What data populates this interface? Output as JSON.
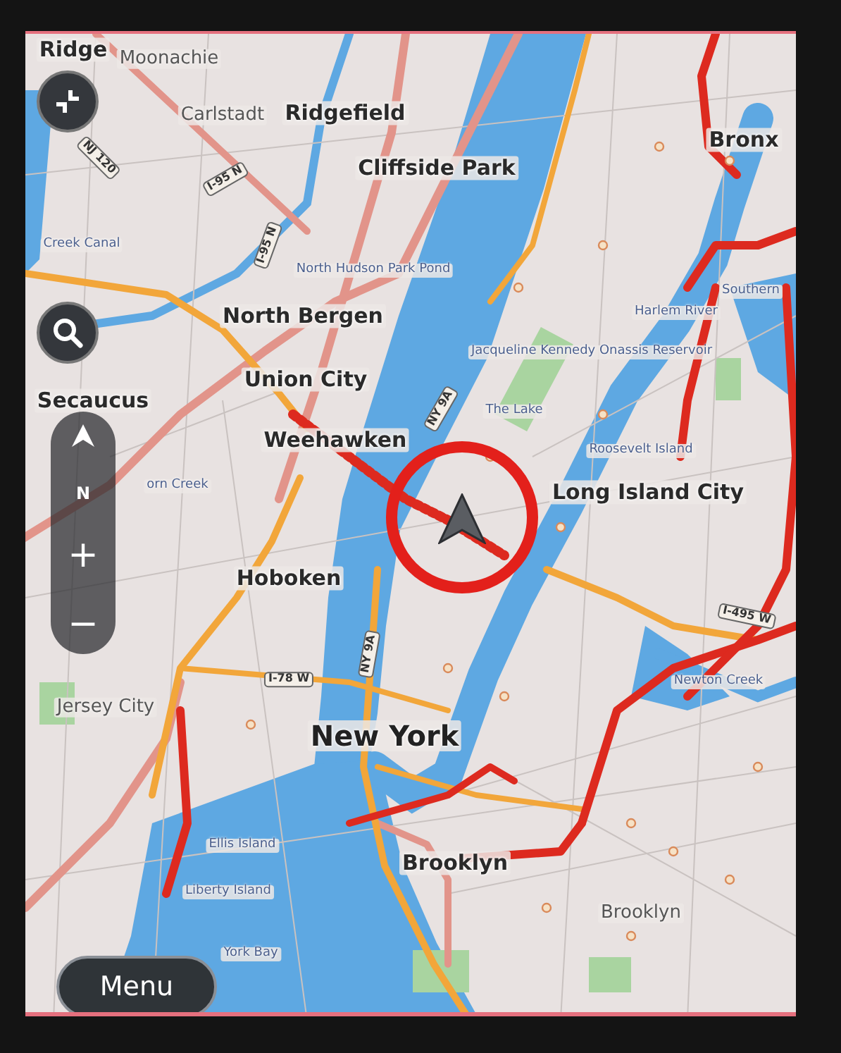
{
  "map": {
    "labels": [
      {
        "text": "Ridge",
        "kind": "town"
      },
      {
        "text": "Moonachie",
        "kind": "district"
      },
      {
        "text": "Carlstadt",
        "kind": "district"
      },
      {
        "text": "Ridgefield",
        "kind": "town"
      },
      {
        "text": "Cliffside Park",
        "kind": "town"
      },
      {
        "text": "Bronx",
        "kind": "town"
      },
      {
        "text": "Creek Canal",
        "kind": "water"
      },
      {
        "text": "North Hudson Park Pond",
        "kind": "water"
      },
      {
        "text": "North Bergen",
        "kind": "town"
      },
      {
        "text": "Harlem River",
        "kind": "water"
      },
      {
        "text": "Southern",
        "kind": "water"
      },
      {
        "text": "Jacqueline Kennedy Onassis Reservoir",
        "kind": "water"
      },
      {
        "text": "Secaucus",
        "kind": "town"
      },
      {
        "text": "Union City",
        "kind": "town"
      },
      {
        "text": "The Lake",
        "kind": "water"
      },
      {
        "text": "Weehawken",
        "kind": "town"
      },
      {
        "text": "Roosevelt Island",
        "kind": "water"
      },
      {
        "text": "Long Island City",
        "kind": "town"
      },
      {
        "text": "orn Creek",
        "kind": "water"
      },
      {
        "text": "Hoboken",
        "kind": "town"
      },
      {
        "text": "Newton Creek",
        "kind": "water"
      },
      {
        "text": "Jersey City",
        "kind": "district"
      },
      {
        "text": "New York",
        "kind": "city"
      },
      {
        "text": "Ellis Island",
        "kind": "water"
      },
      {
        "text": "Liberty Island",
        "kind": "water"
      },
      {
        "text": "Brooklyn",
        "kind": "town"
      },
      {
        "text": "Brooklyn",
        "kind": "district"
      },
      {
        "text": "York Bay",
        "kind": "water"
      },
      {
        "text": "NJ 120",
        "kind": "shield"
      },
      {
        "text": "I-95 N",
        "kind": "shield"
      },
      {
        "text": "I-95 N",
        "kind": "shield"
      },
      {
        "text": "NY 9A",
        "kind": "shield"
      },
      {
        "text": "I-78 W",
        "kind": "shield"
      },
      {
        "text": "NY 9A",
        "kind": "shield"
      },
      {
        "text": "I-495 W",
        "kind": "shield"
      }
    ]
  },
  "zoom_control": {
    "compass_label": "N",
    "zoom_in": "+",
    "zoom_out": "−"
  },
  "menu_button": {
    "label": "Menu"
  }
}
